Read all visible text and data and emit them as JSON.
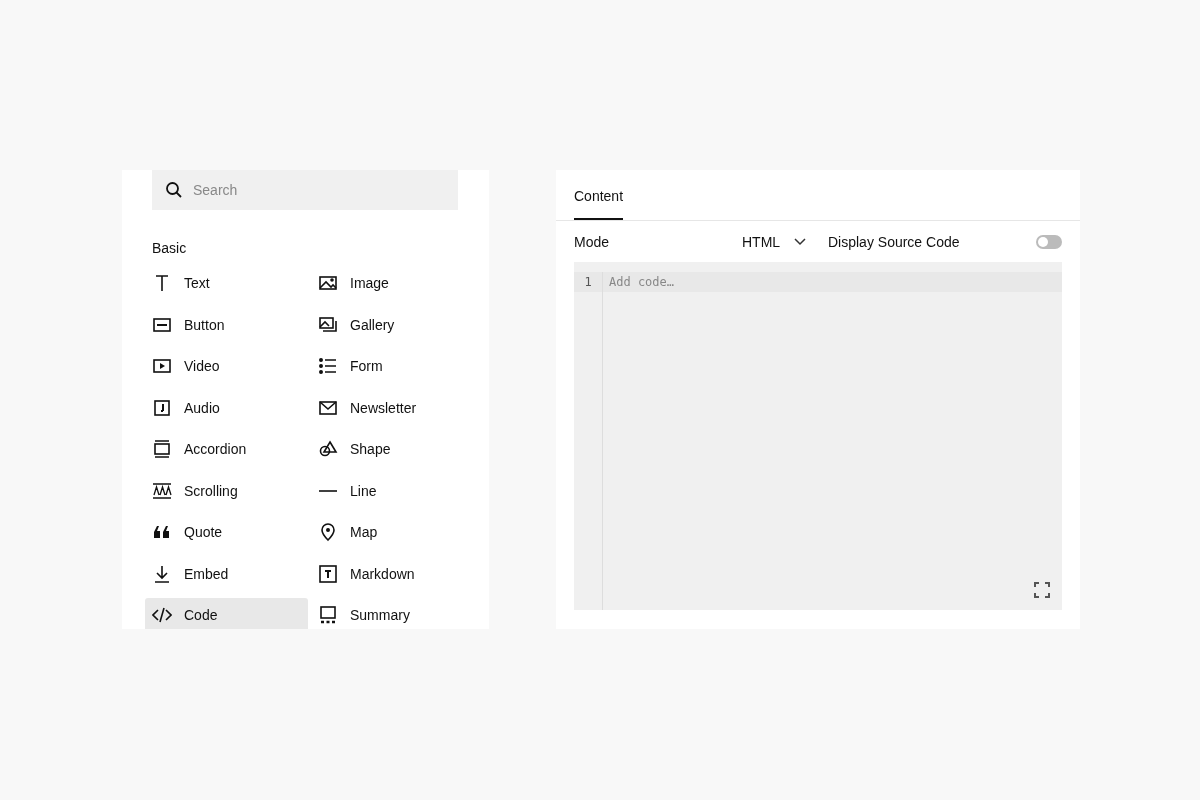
{
  "block_picker": {
    "search": {
      "placeholder": "Search"
    },
    "section_title": "Basic",
    "blocks": [
      {
        "label": "Text",
        "selected": false
      },
      {
        "label": "Image",
        "selected": false
      },
      {
        "label": "Button",
        "selected": false
      },
      {
        "label": "Gallery",
        "selected": false
      },
      {
        "label": "Video",
        "selected": false
      },
      {
        "label": "Form",
        "selected": false
      },
      {
        "label": "Audio",
        "selected": false
      },
      {
        "label": "Newsletter",
        "selected": false
      },
      {
        "label": "Accordion",
        "selected": false
      },
      {
        "label": "Shape",
        "selected": false
      },
      {
        "label": "Scrolling",
        "selected": false
      },
      {
        "label": "Line",
        "selected": false
      },
      {
        "label": "Quote",
        "selected": false
      },
      {
        "label": "Map",
        "selected": false
      },
      {
        "label": "Embed",
        "selected": false
      },
      {
        "label": "Markdown",
        "selected": false
      },
      {
        "label": "Code",
        "selected": true
      },
      {
        "label": "Summary",
        "selected": false
      }
    ]
  },
  "code_settings": {
    "tabs": [
      {
        "label": "Content",
        "selected": true
      }
    ],
    "mode": {
      "label": "Mode",
      "value": "HTML"
    },
    "display_source": {
      "label": "Display Source Code",
      "on": false
    },
    "editor": {
      "lines": [
        {
          "number": "1",
          "placeholder": "Add code…"
        }
      ]
    }
  }
}
